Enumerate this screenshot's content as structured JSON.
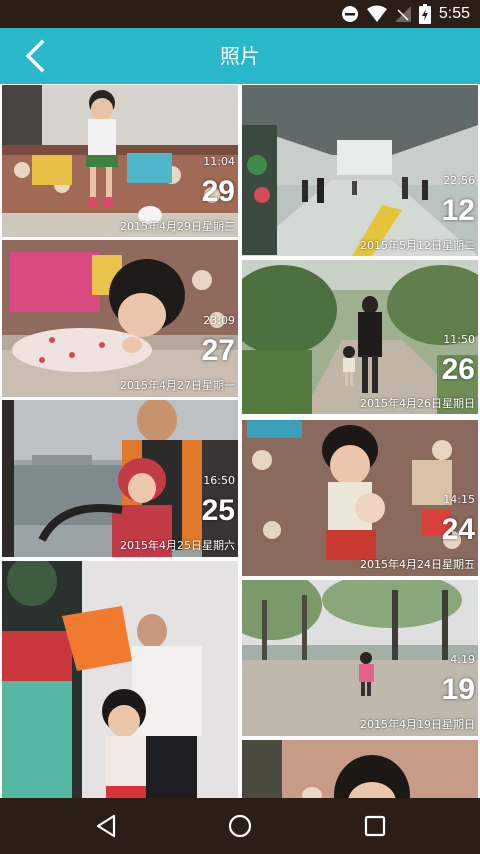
{
  "status_bar": {
    "time": "5:55",
    "icons": [
      "dnd-icon",
      "wifi-icon",
      "no-signal-icon",
      "battery-charging-icon"
    ]
  },
  "app_bar": {
    "title": "照片",
    "back_icon": "back-arrow-icon"
  },
  "photos": [
    {
      "time": "11:04",
      "day": "29",
      "date": "2015年4月29日星期三"
    },
    {
      "time": "22:56",
      "day": "12",
      "date": "2015年5月12日星期二"
    },
    {
      "time": "23:09",
      "day": "27",
      "date": "2015年4月27日星期一"
    },
    {
      "time": "11:50",
      "day": "26",
      "date": "2015年4月26日星期日"
    },
    {
      "time": "16:50",
      "day": "25",
      "date": "2015年4月25日星期六"
    },
    {
      "time": "14:15",
      "day": "24",
      "date": "2015年4月24日星期五"
    },
    {
      "time": "4:19",
      "day": "19",
      "date": "2015年4月19日星期日"
    }
  ],
  "nav_bar": {
    "buttons": [
      "back-triangle-icon",
      "home-circle-icon",
      "recents-square-icon"
    ]
  }
}
